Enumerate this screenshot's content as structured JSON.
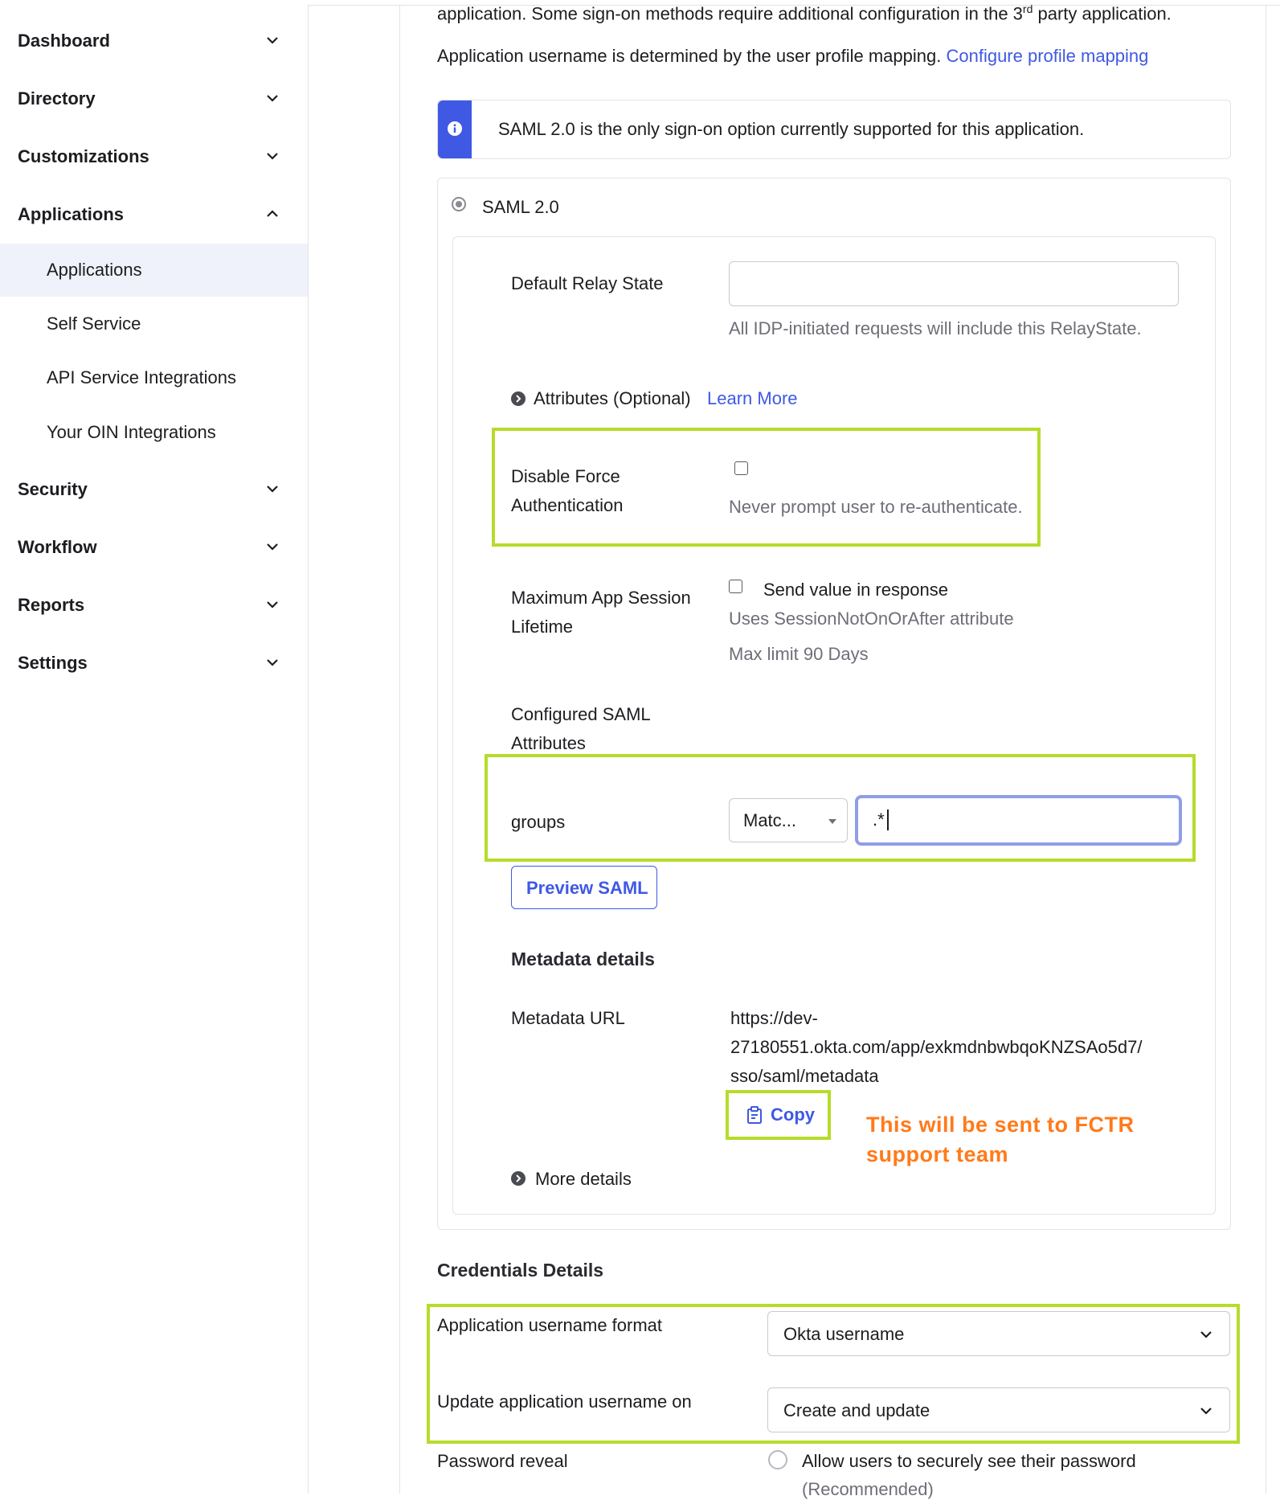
{
  "sidebar": {
    "items": [
      {
        "label": "Dashboard"
      },
      {
        "label": "Directory"
      },
      {
        "label": "Customizations"
      },
      {
        "label": "Applications"
      },
      {
        "label": "Security"
      },
      {
        "label": "Workflow"
      },
      {
        "label": "Reports"
      },
      {
        "label": "Settings"
      }
    ],
    "sub_items": [
      {
        "label": "Applications"
      },
      {
        "label": "Self Service"
      },
      {
        "label": "API Service Integrations"
      },
      {
        "label": "Your OIN Integrations"
      }
    ]
  },
  "intro": {
    "line1_a": "application. Some sign-on methods require additional configuration in the 3",
    "line1_sup": "rd",
    "line1_b": " party application.",
    "line2": "Application username is determined by the user profile mapping.",
    "line2_link": "Configure profile mapping"
  },
  "info_banner": {
    "text": "SAML 2.0 is the only sign-on option currently supported for this application."
  },
  "saml": {
    "radio_label": "SAML 2.0",
    "relay_state_label": "Default Relay State",
    "relay_state_value": "",
    "relay_state_help": "All IDP-initiated requests will include this RelayState.",
    "attributes_label": "Attributes (Optional)",
    "attributes_link": "Learn More",
    "disable_force_label_1": "Disable Force",
    "disable_force_label_2": "Authentication",
    "disable_force_help": "Never prompt user to re-authenticate.",
    "max_session_label_1": "Maximum App Session",
    "max_session_label_2": "Lifetime",
    "send_value_label": "Send value in response",
    "send_value_help": "Uses SessionNotOnOrAfter attribute",
    "max_limit": "Max limit 90 Days",
    "configured_label_1": "Configured SAML",
    "configured_label_2": "Attributes",
    "groups_label": "groups",
    "groups_filter": "Matc...",
    "groups_value": ".*",
    "preview_button": "Preview SAML",
    "metadata_heading": "Metadata details",
    "metadata_url_label": "Metadata URL",
    "metadata_url_1": "https://dev-",
    "metadata_url_2": "27180551.okta.com/app/exkmdnbwbqoKNZSAo5d7/",
    "metadata_url_3": "sso/saml/metadata",
    "copy_button": "Copy",
    "annotation_1": "This will be sent to FCTR",
    "annotation_2": "support team",
    "more_details": "More details"
  },
  "credentials": {
    "heading": "Credentials Details",
    "username_format_label": "Application username format",
    "username_format_value": "Okta username",
    "update_on_label": "Update application username on",
    "update_on_value": "Create and update",
    "password_reveal_label": "Password reveal",
    "password_reveal_option_1": "Allow users to securely see their password",
    "password_reveal_option_2": "(Recommended)"
  },
  "colors": {
    "highlight": "#b6dc2a",
    "link": "#3f59e4",
    "annotation": "#ff7a1a",
    "info_accent": "#3f59e4"
  }
}
